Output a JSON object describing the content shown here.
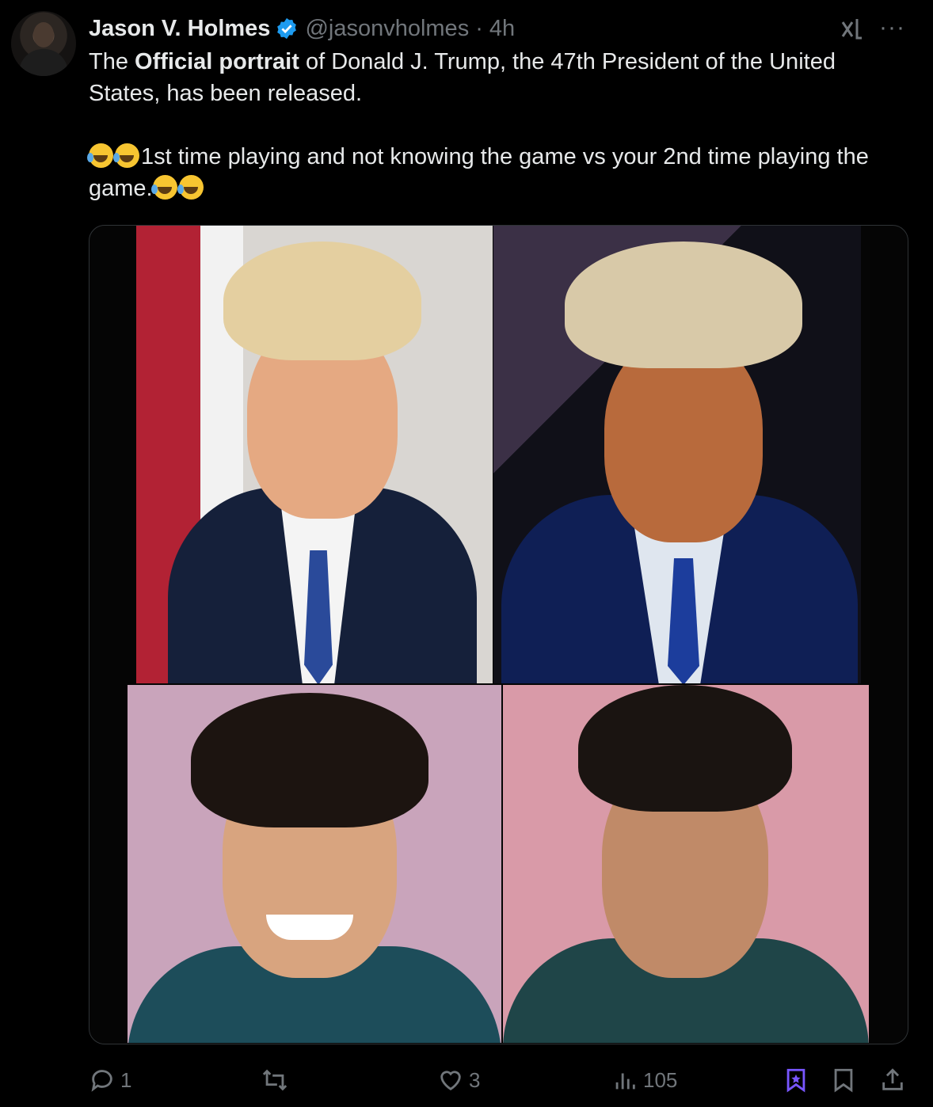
{
  "tweet": {
    "author_name": "Jason V. Holmes",
    "handle": "@jasonvholmes",
    "separator": "·",
    "time": "4h",
    "text_before_bold": "The ",
    "bold": "Official portrait",
    "text_after_bold": " of Donald J. Trump, the 47th President of the United States, has been released.",
    "line2_text": "1st time playing and not knowing the game vs your 2nd time playing the game.",
    "more_label": "···"
  },
  "media": {
    "panels": [
      "trump-smiling-portrait",
      "trump-serious-portrait",
      "squid-game-smiling",
      "squid-game-serious"
    ]
  },
  "actions": {
    "replies": "1",
    "reposts": "",
    "likes": "3",
    "views": "105"
  },
  "colors": {
    "background": "#000000",
    "text": "#e7e9ea",
    "muted": "#71767b",
    "verified": "#1d9bf0",
    "grok": "#7856ff"
  },
  "icons": [
    "verified-badge-icon",
    "grok-icon",
    "more-icon",
    "reply-icon",
    "repost-icon",
    "like-icon",
    "views-icon",
    "grok-bookmark-icon",
    "bookmark-icon",
    "share-icon"
  ]
}
